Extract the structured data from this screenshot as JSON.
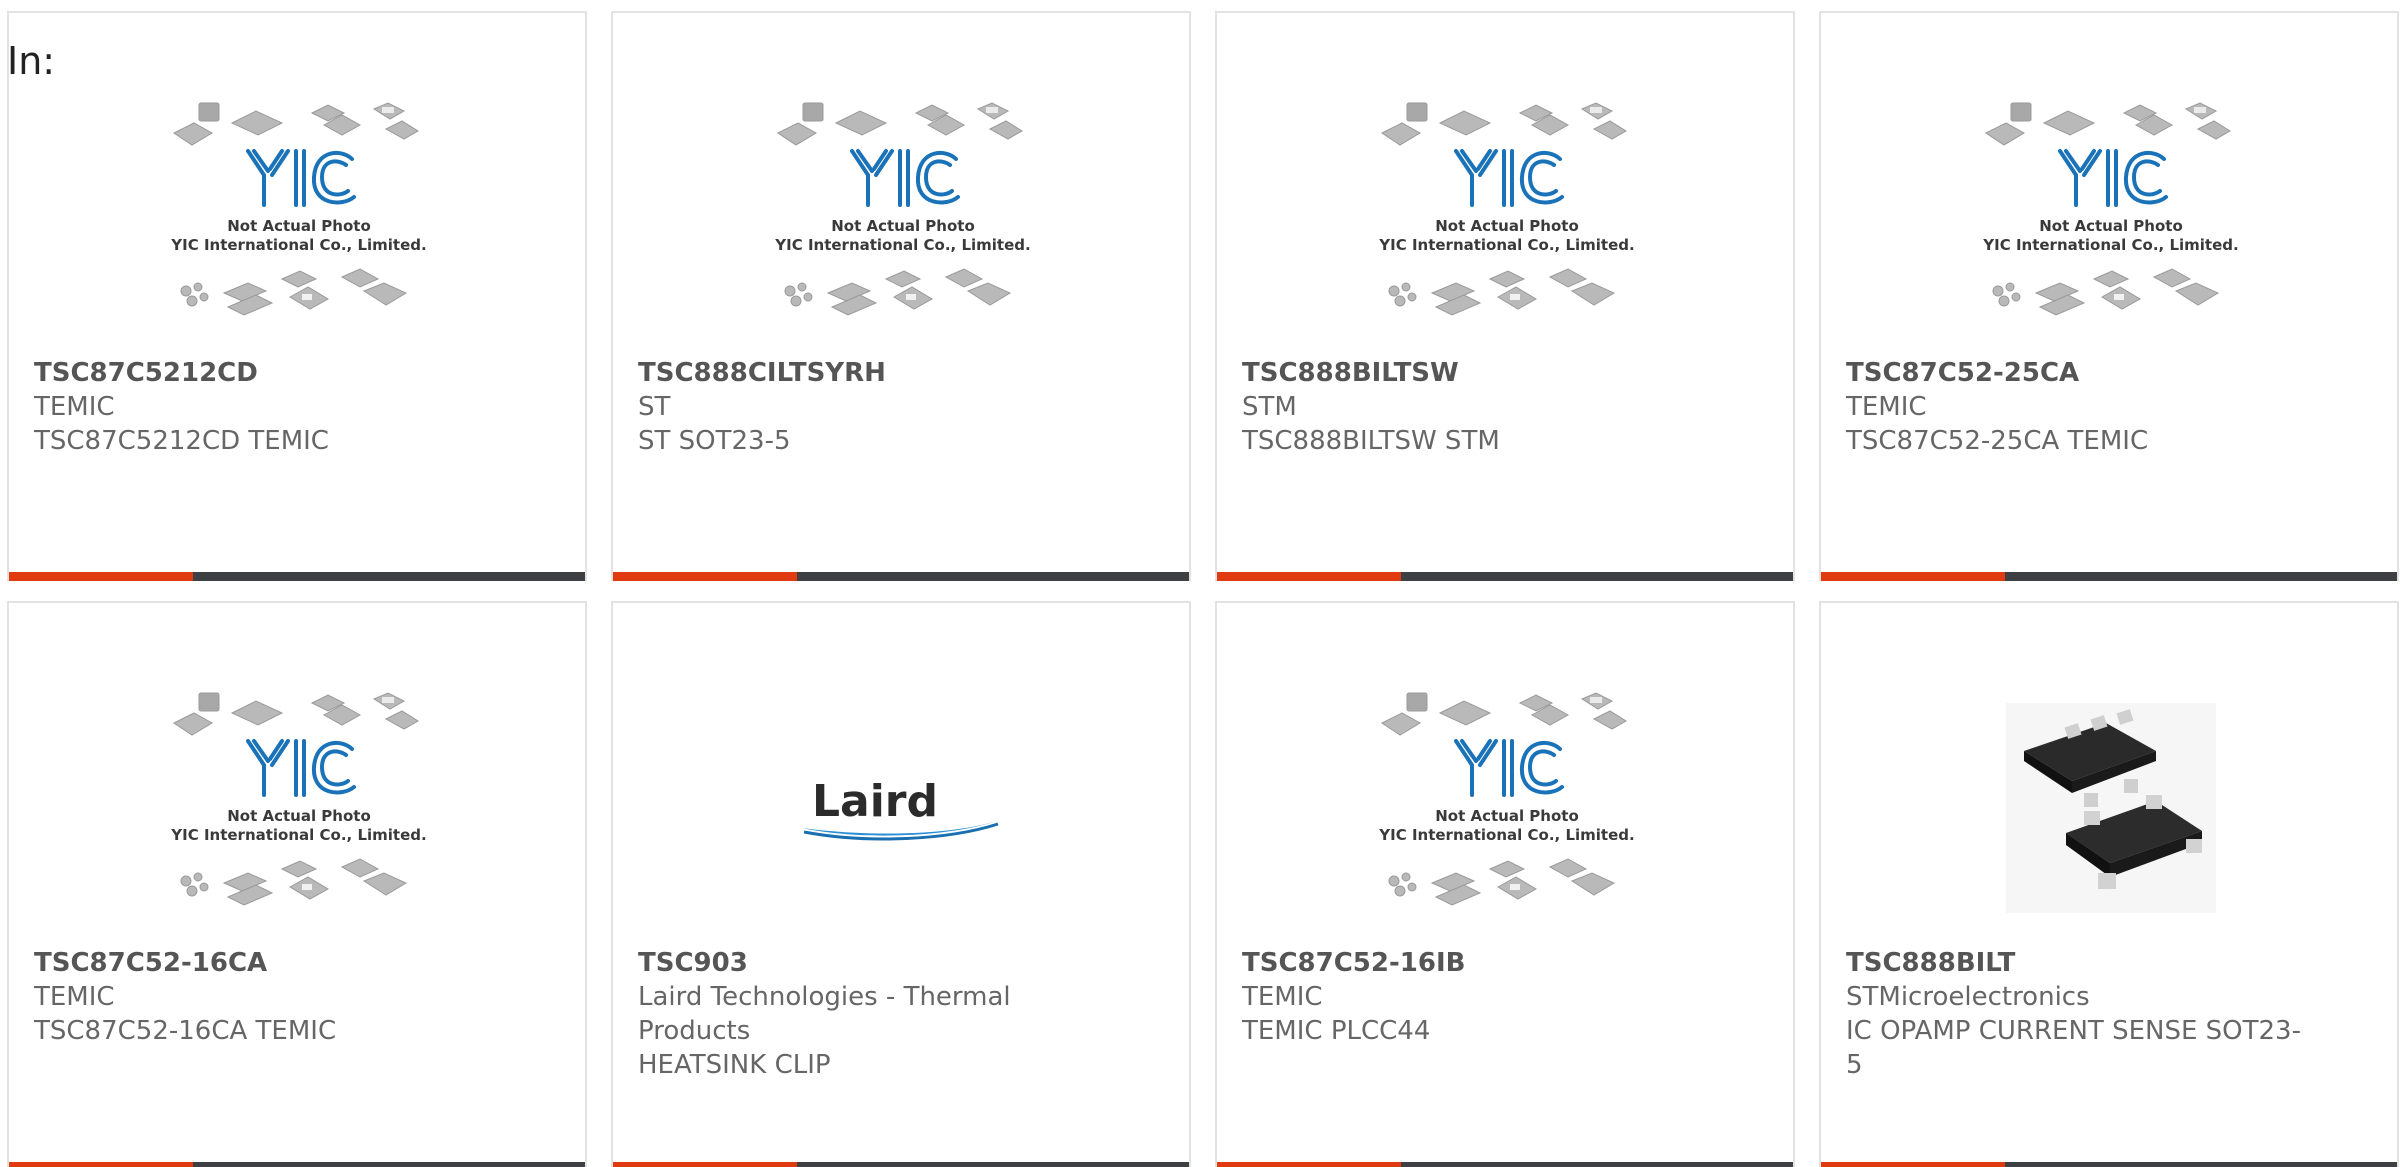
{
  "filter_label": "In:",
  "placeholder": {
    "logo_text": "YIC",
    "line1": "Not Actual Photo",
    "line2": "YIC International Co., Limited."
  },
  "laird_logo_text": "Laird",
  "colors": {
    "accent": "#e03b10",
    "bar": "#3d3f42",
    "yic_blue": "#1a73b8",
    "text": "#666666"
  },
  "products": [
    {
      "part_number": "TSC87C5212CD",
      "manufacturer": "TEMIC",
      "description": [
        "TSC87C5212CD TEMIC"
      ],
      "image": "yic-placeholder"
    },
    {
      "part_number": "TSC888CILTSYRH",
      "manufacturer": "ST",
      "description": [
        "ST SOT23-5"
      ],
      "image": "yic-placeholder"
    },
    {
      "part_number": "TSC888BILTSW",
      "manufacturer": "STM",
      "description": [
        "TSC888BILTSW STM"
      ],
      "image": "yic-placeholder"
    },
    {
      "part_number": "TSC87C52-25CA",
      "manufacturer": "TEMIC",
      "description": [
        "TSC87C52-25CA TEMIC"
      ],
      "image": "yic-placeholder"
    },
    {
      "part_number": "TSC87C52-16CA",
      "manufacturer": "TEMIC",
      "description": [
        "TSC87C52-16CA TEMIC"
      ],
      "image": "yic-placeholder"
    },
    {
      "part_number": "TSC903",
      "manufacturer": "Laird Technologies - Thermal Products",
      "description": [
        "HEATSINK CLIP"
      ],
      "image": "laird-logo"
    },
    {
      "part_number": "TSC87C52-16IB",
      "manufacturer": "TEMIC",
      "description": [
        "TEMIC PLCC44"
      ],
      "image": "yic-placeholder"
    },
    {
      "part_number": "TSC888BILT",
      "manufacturer": "STMicroelectronics",
      "description": [
        "IC OPAMP CURRENT SENSE SOT23-5"
      ],
      "image": "sot23-chip-photo"
    }
  ]
}
